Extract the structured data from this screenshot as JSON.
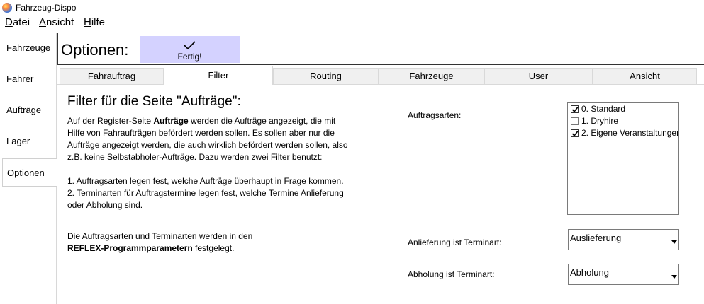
{
  "window": {
    "title": "Fahrzeug-Dispo",
    "icon": "app-globe-icon"
  },
  "menu": [
    {
      "label": "Datei",
      "mnemonic": "D",
      "rest": "atei"
    },
    {
      "label": "Ansicht",
      "mnemonic": "A",
      "rest": "nsicht"
    },
    {
      "label": "Hilfe",
      "mnemonic": "H",
      "rest": "ilfe"
    }
  ],
  "sidebar": {
    "items": [
      {
        "label": "Fahrzeuge"
      },
      {
        "label": "Fahrer"
      },
      {
        "label": "Aufträge"
      },
      {
        "label": "Lager"
      },
      {
        "label": "Optionen",
        "active": true
      }
    ]
  },
  "options": {
    "title": "Optionen:",
    "done_label": "Fertig!",
    "done_icon": "checkmark-icon",
    "done_color": "#d4d2ff"
  },
  "tabs": [
    {
      "label": "Fahrauftrag"
    },
    {
      "label": "Filter",
      "active": true
    },
    {
      "label": "Routing"
    },
    {
      "label": "Fahrzeuge"
    },
    {
      "label": "User"
    },
    {
      "label": "Ansicht"
    }
  ],
  "filter_page": {
    "heading": "Filter für die Seite \"Aufträge\":",
    "intro": {
      "line1_pre": "Auf der Register-Seite ",
      "line1_bold": "Aufträge",
      "line1_post": " werden die Aufträge angezeigt, die mit",
      "line2": "Hilfe von Fahraufträgen befördert werden sollen. Es sollen aber nur die",
      "line3": "Aufträge angezeigt werden, die auch wirklich befördert werden sollen, also",
      "line4": "z.B. keine Selbstabholer-Aufträge. Dazu werden zwei Filter benutzt:"
    },
    "points": {
      "p1": "1. Auftragsarten legen fest, welche Aufträge überhaupt in Frage kommen.",
      "p2a": "2. Terminarten für Auftragstermine legen fest, welche Termine Anlieferung",
      "p2b": "oder Abholung sind."
    },
    "note": {
      "line1": "Die Auftragsarten und Terminarten werden in den",
      "line2_bold": "REFLEX-Programmparametern",
      "line2_post": " festgelegt."
    },
    "order_types": {
      "label": "Auftragsarten:",
      "items": [
        {
          "label": "0. Standard",
          "checked": true
        },
        {
          "label": "1. Dryhire",
          "checked": false
        },
        {
          "label": "2. Eigene Veranstaltungen",
          "checked": true
        }
      ]
    },
    "delivery": {
      "label": "Anlieferung ist Terminart:",
      "value": "Auslieferung"
    },
    "pickup": {
      "label": "Abholung ist Terminart:",
      "value": "Abholung"
    }
  }
}
